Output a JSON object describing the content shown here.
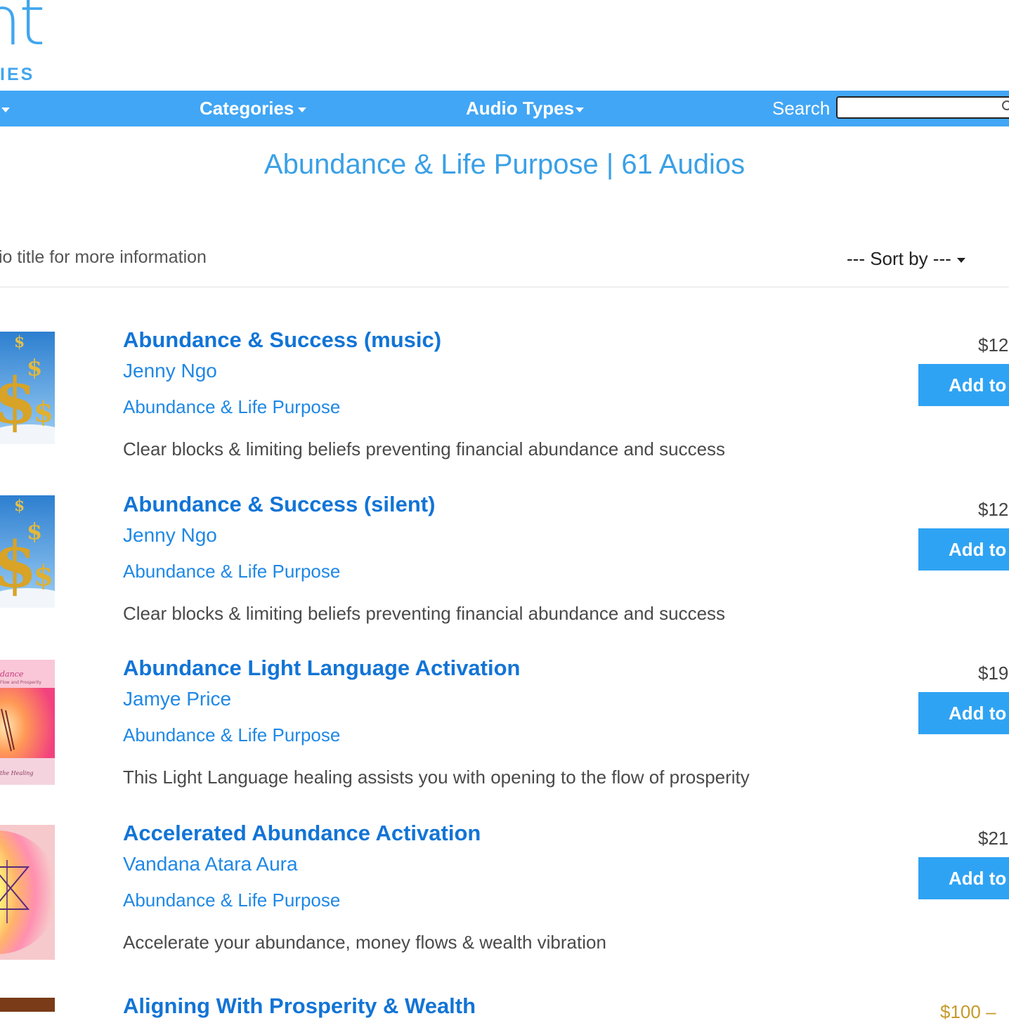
{
  "logo": {
    "text": "nt",
    "subtitle": "IES"
  },
  "nav": {
    "first_caret_label": "",
    "categories": "Categories",
    "audio_types": "Audio Types",
    "search_label": "Search",
    "search_value": ""
  },
  "page": {
    "title": "Abundance & Life Purpose | 61 Audios",
    "hint": "io title for more information",
    "sort_label": "--- Sort by ---"
  },
  "items": [
    {
      "title": "Abundance & Success (music)",
      "author": "Jenny Ngo",
      "category": "Abundance & Life Purpose",
      "description": "Clear blocks & limiting beliefs preventing financial abundance and success",
      "price": "$12",
      "button": "Add to",
      "thumb": "money-icon"
    },
    {
      "title": "Abundance & Success (silent)",
      "author": "Jenny Ngo",
      "category": "Abundance & Life Purpose",
      "description": "Clear blocks & limiting beliefs preventing financial abundance and success",
      "price": "$12",
      "button": "Add to",
      "thumb": "money-icon"
    },
    {
      "title": "Abundance Light Language Activation",
      "author": "Jamye Price",
      "category": "Abundance & Life Purpose",
      "description": "This Light Language healing assists you with opening to the flow of prosperity",
      "price": "$19",
      "button": "Add to",
      "thumb": "light-art-icon"
    },
    {
      "title": "Accelerated Abundance Activation",
      "author": "Vandana Atara Aura",
      "category": "Abundance & Life Purpose",
      "description": "Accelerate your abundance, money flows & wealth vibration",
      "price": "$21",
      "button": "Add to",
      "thumb": "rainbow-star-icon"
    }
  ],
  "partial_item": {
    "title": "Aligning With Prosperity & Wealth",
    "price": "$100 – "
  },
  "colors": {
    "brand_blue": "#41a6f5",
    "link_blue": "#1274d6",
    "price_gold": "#c89a2a"
  }
}
